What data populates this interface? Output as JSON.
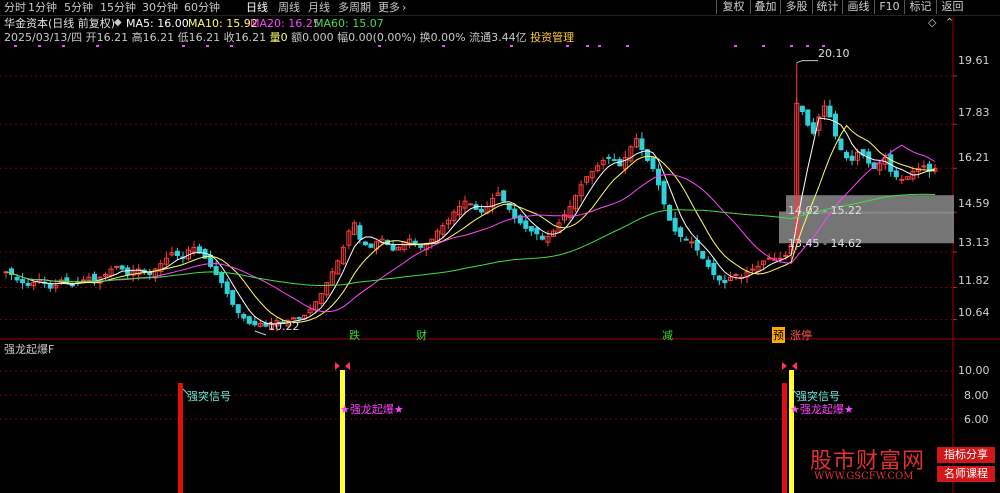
{
  "toolbar": {
    "periods": [
      "分时",
      "1分钟",
      "5分钟",
      "15分钟",
      "30分钟",
      "60分钟",
      "日线",
      "周线",
      "月线",
      "多周期",
      "更多"
    ],
    "active_period": "日线",
    "more_chevron": "›",
    "right_buttons": [
      "复权",
      "叠加",
      "多股",
      "统计",
      "画线",
      "F10",
      "标记",
      "返回"
    ]
  },
  "header": {
    "stock_title": "华金资本(日线 前复权)",
    "ma5": "MA5: 16.00",
    "ma10": "MA10: 15.92",
    "ma20": "MA20: 16.25",
    "ma60": "MA60: 15.07",
    "quote_date": "2025/03/13/四",
    "quote_open": "开16.21",
    "quote_high": "高16.21",
    "quote_low": "低16.21",
    "quote_close": "收16.21",
    "quote_volume": "量0",
    "quote_amount": "额0.000",
    "quote_change": "幅0.00(0.00%)",
    "quote_turnover": "换0.00%",
    "quote_float": "流通3.44亿",
    "quote_link": "投资管理"
  },
  "main_axis": {
    "ticks": [
      "19.61",
      "17.83",
      "16.21",
      "14.59",
      "13.13",
      "11.82",
      "10.64"
    ]
  },
  "annotations": {
    "high_label": "20.10",
    "low_label": "10.22",
    "zone_upper": "14.02 - 15.22",
    "zone_lower": "13.45 - 14.62",
    "event_die": "跌",
    "event_cai": "财",
    "event_jian": "减",
    "event_yu": "预",
    "event_zhangting": "涨停"
  },
  "indicator": {
    "title": "强龙起爆F",
    "ticks": [
      "10.00",
      "8.00",
      "6.00"
    ],
    "signal1": "强突信号",
    "signal2": "强突信号",
    "burst1": "★强龙起爆★",
    "burst2": "★强龙起爆★"
  },
  "watermark": {
    "site_name": "股市财富网",
    "url": "WWW.GSCFW.COM",
    "tag1": "指标分享",
    "tag2": "名师课程"
  },
  "colors": {
    "up": "#ff3c3c",
    "down": "#30d0d8",
    "ma5": "#ffffff",
    "ma10": "#ffff66",
    "ma20": "#ff44ff",
    "ma60": "#44dd44",
    "grid": "#7a0000",
    "zone": "#8a8a8a"
  },
  "chart_data": {
    "type": "candlestick",
    "title": "华金资本(日线 前复权)",
    "y_axis_ticks": [
      19.61,
      17.83,
      16.21,
      14.59,
      13.13,
      11.82,
      10.64
    ],
    "price_high": 20.1,
    "price_low": 10.22,
    "last_close": 16.21,
    "moving_averages": [
      {
        "name": "MA5",
        "last": 16.0
      },
      {
        "name": "MA10",
        "last": 15.92
      },
      {
        "name": "MA20",
        "last": 16.25
      },
      {
        "name": "MA60",
        "last": 15.07
      }
    ],
    "closes": [
      12.4,
      12.3,
      12.1,
      12.0,
      11.9,
      12.0,
      12.1,
      12.0,
      11.8,
      11.9,
      12.1,
      12.0,
      11.9,
      12.0,
      12.1,
      12.2,
      12.0,
      12.2,
      12.3,
      12.5,
      12.6,
      12.5,
      12.3,
      12.4,
      12.5,
      12.4,
      12.3,
      12.5,
      12.7,
      12.9,
      13.1,
      13.0,
      12.9,
      13.2,
      13.3,
      13.1,
      12.9,
      12.6,
      12.3,
      12.0,
      11.6,
      11.2,
      10.9,
      10.7,
      10.5,
      10.45,
      10.5,
      10.4,
      10.5,
      10.6,
      10.5,
      10.6,
      10.7,
      10.7,
      10.8,
      11.0,
      11.3,
      11.6,
      12.0,
      12.4,
      12.8,
      13.3,
      13.9,
      14.2,
      13.6,
      13.4,
      13.3,
      13.5,
      13.6,
      13.4,
      13.2,
      13.3,
      13.5,
      13.6,
      13.4,
      13.3,
      13.4,
      13.6,
      13.9,
      14.1,
      14.3,
      14.6,
      14.8,
      15.0,
      14.9,
      14.7,
      14.6,
      14.8,
      15.1,
      15.3,
      15.0,
      14.7,
      14.4,
      14.2,
      14.0,
      13.9,
      13.8,
      13.6,
      13.7,
      13.9,
      14.2,
      14.5,
      14.8,
      15.2,
      15.6,
      15.9,
      16.1,
      16.3,
      16.5,
      16.6,
      16.5,
      16.3,
      16.6,
      17.0,
      17.3,
      16.9,
      16.5,
      16.2,
      15.6,
      14.9,
      14.3,
      13.9,
      13.7,
      13.6,
      13.5,
      13.2,
      12.9,
      12.6,
      12.3,
      12.1,
      12.0,
      12.2,
      12.3,
      12.2,
      12.4,
      12.5,
      12.6,
      12.8,
      12.9,
      12.9,
      12.9,
      13.0,
      13.4,
      18.6,
      18.3,
      17.8,
      17.5,
      18.1,
      18.5,
      18.1,
      17.4,
      16.9,
      16.6,
      16.5,
      16.8,
      16.7,
      16.4,
      16.2,
      16.4,
      16.6,
      16.1,
      15.9,
      15.8,
      15.9,
      16.1,
      16.2,
      16.3,
      16.1,
      16.21
    ],
    "event_markers": [
      "跌",
      "财",
      "减",
      "预",
      "涨停"
    ],
    "support_zones": [
      "14.02 - 15.22",
      "13.45 - 14.62"
    ],
    "indicator": {
      "name": "强龙起爆F",
      "y_axis_ticks": [
        10.0,
        8.0,
        6.0
      ],
      "signals": [
        "强突信号",
        "★强龙起爆★",
        "强突信号",
        "★强龙起爆★"
      ]
    }
  }
}
